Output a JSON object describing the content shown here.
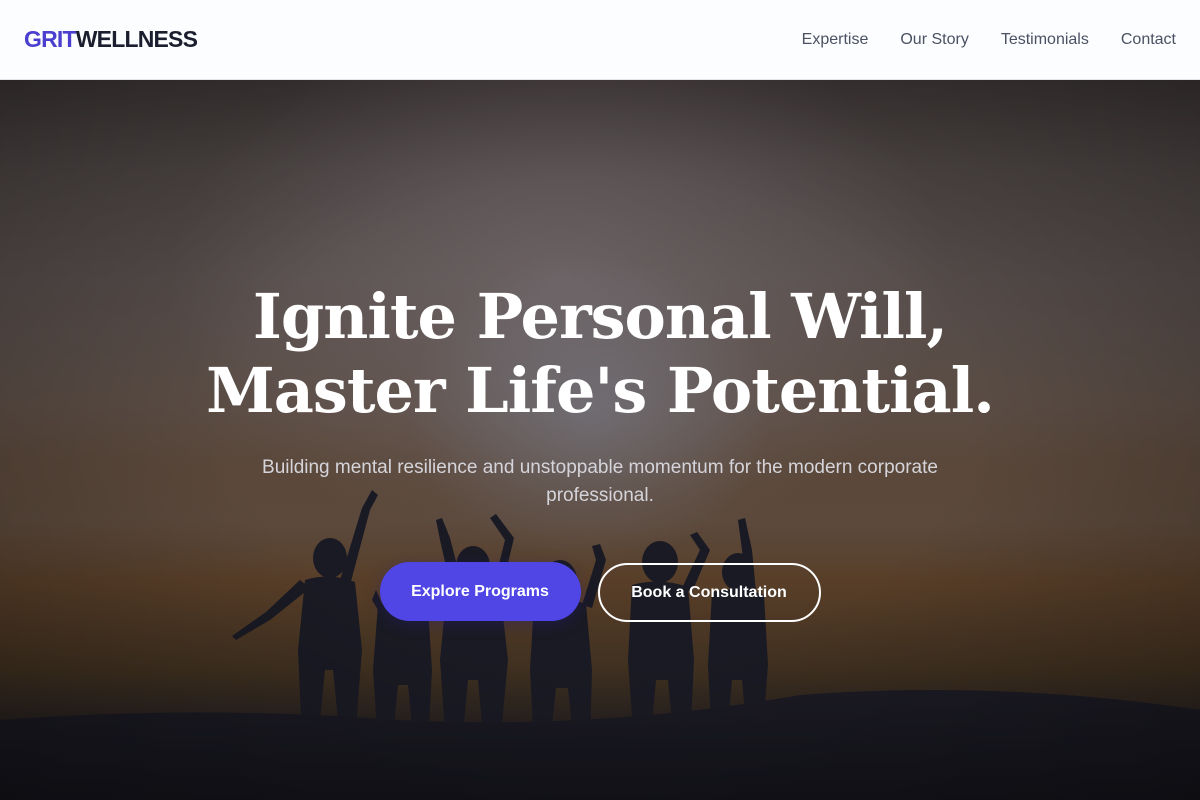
{
  "brand": {
    "logo_accent": "GRIT",
    "logo_rest": "WELLNESS",
    "accent_color": "#4b3fd0",
    "dark_color": "#1b1e2e"
  },
  "nav": {
    "items": [
      {
        "label": "Expertise"
      },
      {
        "label": "Our Story"
      },
      {
        "label": "Testimonials"
      },
      {
        "label": "Contact"
      }
    ]
  },
  "hero": {
    "headline_line1": "Ignite Personal Will,",
    "headline_line2": "Master Life's Potential.",
    "subheadline": "Building mental resilience and unstoppable momentum for the modern corporate professional.",
    "primary_cta": "Explore Programs",
    "secondary_cta": "Book a Consultation",
    "primary_color": "#4f46e5",
    "background_image": "silhouettes-of-people-raising-arms-at-sunset-icon"
  }
}
